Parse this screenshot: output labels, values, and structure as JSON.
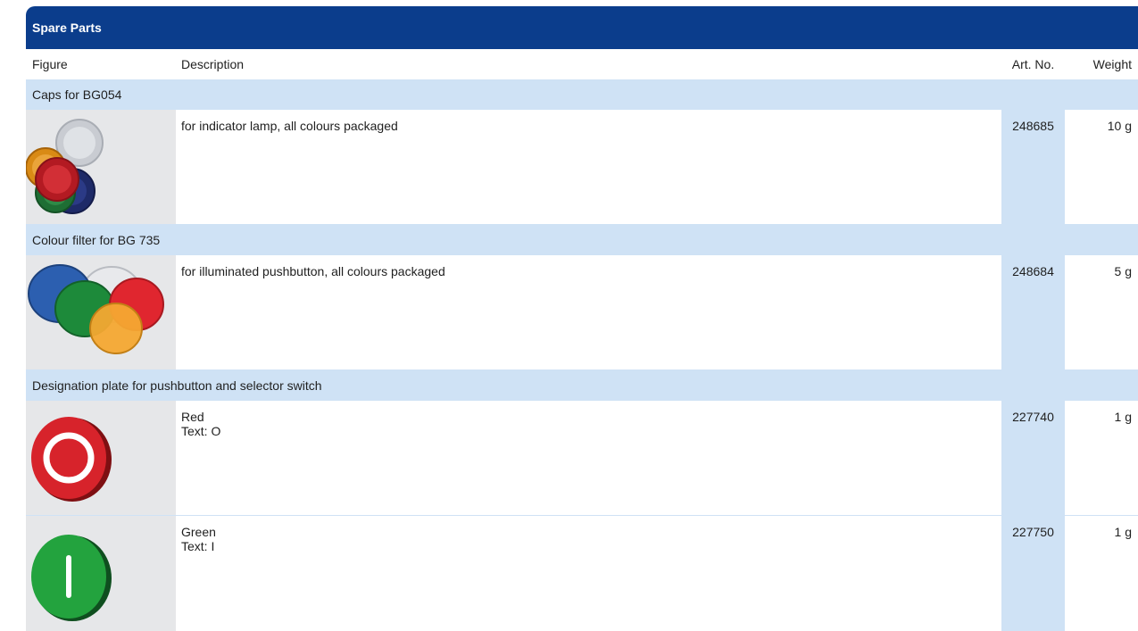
{
  "title": "Spare Parts",
  "columns": {
    "figure": "Figure",
    "description": "Description",
    "art_no": "Art. No.",
    "weight": "Weight"
  },
  "sections": [
    {
      "title": "Caps for BG054",
      "items": [
        {
          "figure_icon": "indicator-lamp-caps-icon",
          "lines": [
            "for indicator lamp, all colours packaged"
          ],
          "art_no": "248685",
          "weight": "10 g"
        }
      ]
    },
    {
      "title": "Colour filter for BG 735",
      "items": [
        {
          "figure_icon": "colour-filters-icon",
          "lines": [
            "for illuminated pushbutton, all colours packaged"
          ],
          "art_no": "248684",
          "weight": "5 g"
        }
      ]
    },
    {
      "title": "Designation plate for pushbutton and selector switch",
      "items": [
        {
          "figure_icon": "red-plate-o-icon",
          "lines": [
            "Red",
            "Text: O"
          ],
          "art_no": "227740",
          "weight": "1 g"
        },
        {
          "figure_icon": "green-plate-i-icon",
          "lines": [
            "Green",
            "Text: I"
          ],
          "art_no": "227750",
          "weight": "1 g"
        }
      ]
    }
  ],
  "colors": {
    "header_bg": "#0b3d8c",
    "section_bg": "#cfe2f5",
    "figure_bg": "#e6e7e9"
  }
}
